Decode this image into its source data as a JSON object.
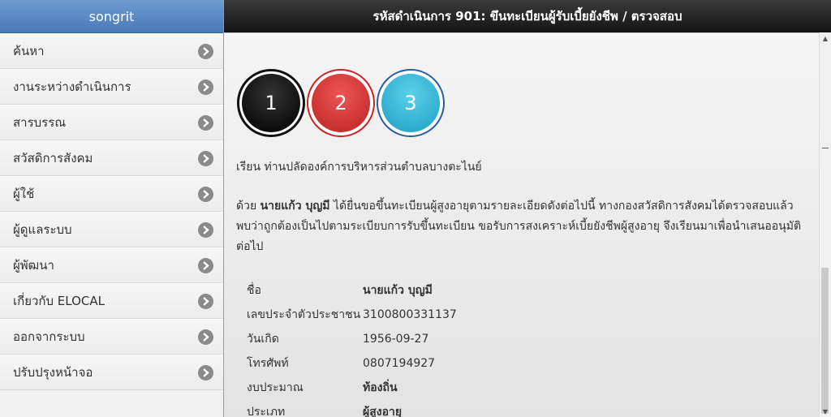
{
  "sidebar": {
    "title": "songrit",
    "items": [
      {
        "label": "ค้นหา"
      },
      {
        "label": "งานระหว่างดำเนินการ"
      },
      {
        "label": "สารบรรณ"
      },
      {
        "label": "สวัสดิการสังคม"
      },
      {
        "label": "ผู้ใช้"
      },
      {
        "label": "ผู้ดูแลระบบ"
      },
      {
        "label": "ผู้พัฒนา"
      },
      {
        "label": "เกี่ยวกับ ELOCAL"
      },
      {
        "label": "ออกจากระบบ"
      },
      {
        "label": "ปรับปรุงหน้าจอ"
      }
    ]
  },
  "header": {
    "title": "รหัสดำเนินการ 901: ขึนทะเบียนผู้รับเบี้ยยังชีพ / ตรวจสอบ"
  },
  "steps": [
    "1",
    "2",
    "3"
  ],
  "letter": {
    "salutation": "เรียน ท่านปลัดองค์การบริหารส่วนตำบลบางตะไนย์",
    "body_prefix": "ด้วย ",
    "body_name": "นายแก้ว บุญมี",
    "body_line1": " ได้ยื่นขอขึ้นทะเบียนผู้สูงอายุตามรายละเอียดดังต่อไปนี้ ทางกองสวัสดิการสังคมได้ตรวจสอบแล้ว",
    "body_line2": "พบว่าถูกต้องเป็นไปตามระเบียบการรับขึ้นทะเบียน ขอรับการสงเคราะห์เบี้ยยังชีพผู้สูงอายุ จึงเรียนมาเพื่อนำเสนออนุมัติ",
    "body_line3": "ต่อไป"
  },
  "info": {
    "name_label": "ชื่อ",
    "name_value": "นายแก้ว บุญมี",
    "id_label": "เลขประจำตัวประชาชน",
    "id_value": "3100800331137",
    "dob_label": "วันเกิด",
    "dob_value": "1956-09-27",
    "phone_label": "โทรศัพท์",
    "phone_value": "0807194927",
    "budget_label": "งบประมาณ",
    "budget_value": "ท้องถิ่น",
    "type_label": "ประเภท",
    "type_value": "ผู้สูงอายุ"
  },
  "colors": {
    "sidebar_header": "#4a79b8",
    "main_header": "#1a1a1a",
    "step1": "#000000",
    "step2": "#cc3333",
    "step3": "#2aaad0"
  },
  "icons": {
    "chevron": "chevron-right-icon"
  }
}
